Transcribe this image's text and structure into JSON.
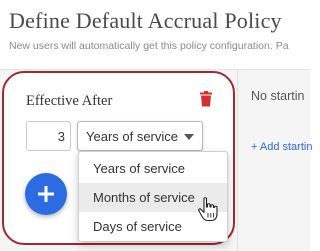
{
  "header": {
    "title": "Define Default Accrual Policy",
    "subtitle": "New users will automatically get this policy configuration. Pa"
  },
  "rule_card": {
    "title": "Effective After",
    "quantity": "3",
    "unit_selected": "Years of service",
    "delete_icon": "trash-icon",
    "add_icon": "plus-icon"
  },
  "dropdown": {
    "options": [
      {
        "label": "Years of service"
      },
      {
        "label": "Months of service"
      },
      {
        "label": "Days of service"
      }
    ],
    "hovered_option": "Months of service"
  },
  "right_panel": {
    "empty_text": "No startin",
    "add_link": "+ Add startin"
  },
  "colors": {
    "accent_blue": "#2d6be3",
    "highlight_red": "#a3282d",
    "delete_red": "#d32f2f"
  },
  "cursor": "hand-pointer-icon"
}
